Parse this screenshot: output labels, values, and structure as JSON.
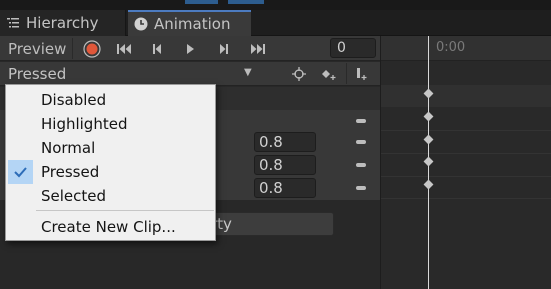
{
  "tabs": {
    "hierarchy_label": "Hierarchy",
    "animation_label": "Animation"
  },
  "toolbar": {
    "preview_label": "Preview",
    "frame_value": "0"
  },
  "clip": {
    "selected": "Pressed"
  },
  "timeline": {
    "ruler_label": "0:00"
  },
  "properties": {
    "values": [
      "0.8",
      "0.8",
      "0.8"
    ],
    "add_property_label_visible": "rty"
  },
  "menu": {
    "items": [
      "Disabled",
      "Highlighted",
      "Normal",
      "Pressed",
      "Selected"
    ],
    "checked_item": "Pressed",
    "create_label": "Create New Clip..."
  },
  "colors": {
    "record_red": "#e0573a",
    "tab_accent": "#4c7bc0",
    "check_highlight": "#b4d5f5",
    "check_mark": "#2d6db8"
  },
  "icons": [
    "hierarchy-icon",
    "animation-clock-icon",
    "record-icon",
    "first-key-icon",
    "prev-key-icon",
    "play-icon",
    "next-key-icon",
    "last-key-icon",
    "dropdown-arrow-icon",
    "filter-by-selection-icon",
    "add-keyframe-icon",
    "add-event-icon",
    "checkmark-icon",
    "property-menu-icon"
  ]
}
